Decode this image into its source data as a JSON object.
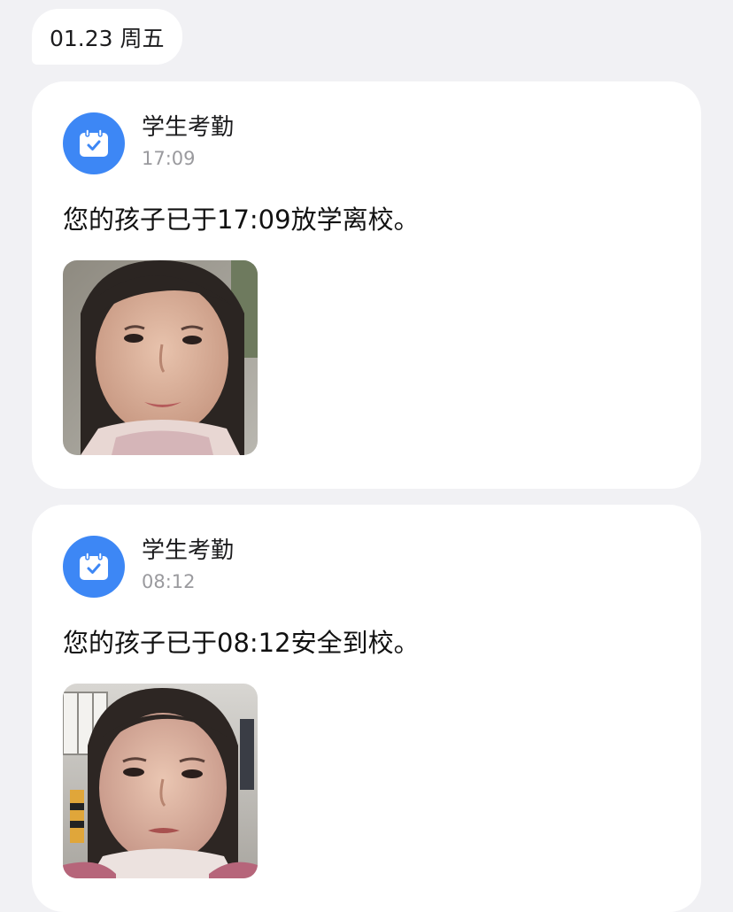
{
  "date_chip": "01.23 周五",
  "records": [
    {
      "app_name": "学生考勤",
      "time": "17:09",
      "message": "您的孩子已于17:09放学离校。"
    },
    {
      "app_name": "学生考勤",
      "time": "08:12",
      "message": "您的孩子已于08:12安全到校。"
    }
  ],
  "icons": {
    "app_icon": "calendar-check-icon"
  },
  "colors": {
    "accent": "#3d87f5",
    "background": "#f1f1f4",
    "card": "#ffffff",
    "muted_text": "#9a9a9e"
  }
}
